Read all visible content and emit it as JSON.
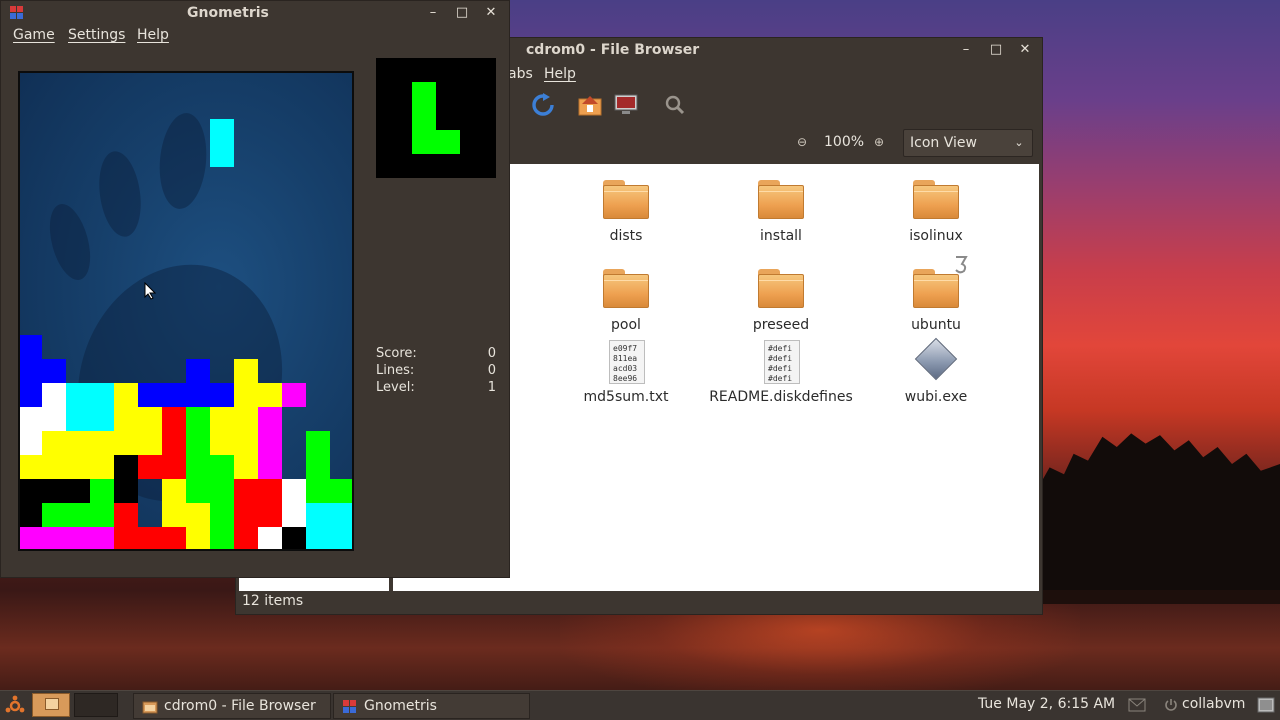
{
  "desktop": {
    "wallpaper": "sunset-over-water"
  },
  "file_browser": {
    "title": "cdrom0 - File Browser",
    "menu": {
      "tabs": "abs",
      "help": "Help"
    },
    "zoom": {
      "value": "100%"
    },
    "view_mode": "Icon View",
    "status": "12 items",
    "items": [
      {
        "name": "dists",
        "type": "folder"
      },
      {
        "name": "install",
        "type": "folder"
      },
      {
        "name": "isolinux",
        "type": "folder"
      },
      {
        "name": "pool",
        "type": "folder"
      },
      {
        "name": "preseed",
        "type": "folder"
      },
      {
        "name": "ubuntu",
        "type": "folder"
      },
      {
        "name": "md5sum.txt",
        "type": "text-file",
        "preview": "e09f7\n811ea\nacd03\n8ee96"
      },
      {
        "name": "README.diskdefines",
        "type": "text-file",
        "preview": "#defi\n#defi\n#defi\n#defi"
      },
      {
        "name": "wubi.exe",
        "type": "executable"
      }
    ]
  },
  "gnometris": {
    "title": "Gnometris",
    "menu": {
      "game": "Game",
      "settings": "Settings",
      "help": "Help"
    },
    "stats": {
      "score_label": "Score:",
      "score": "0",
      "lines_label": "Lines:",
      "lines": "0",
      "level_label": "Level:",
      "level": "1"
    },
    "next_piece": "L",
    "colors": {
      "cyan": "#00ffff",
      "blue": "#0000ff",
      "yellow": "#ffff00",
      "red": "#ff0000",
      "green": "#00ff00",
      "magenta": "#ff00ff",
      "white": "#ffffff",
      "black": "#000000"
    }
  },
  "taskbar": {
    "tasks": [
      {
        "label": "cdrom0 - File Browser"
      },
      {
        "label": "Gnometris"
      }
    ],
    "clock": "Tue May  2,  6:15 AM",
    "user": "collabvm"
  }
}
